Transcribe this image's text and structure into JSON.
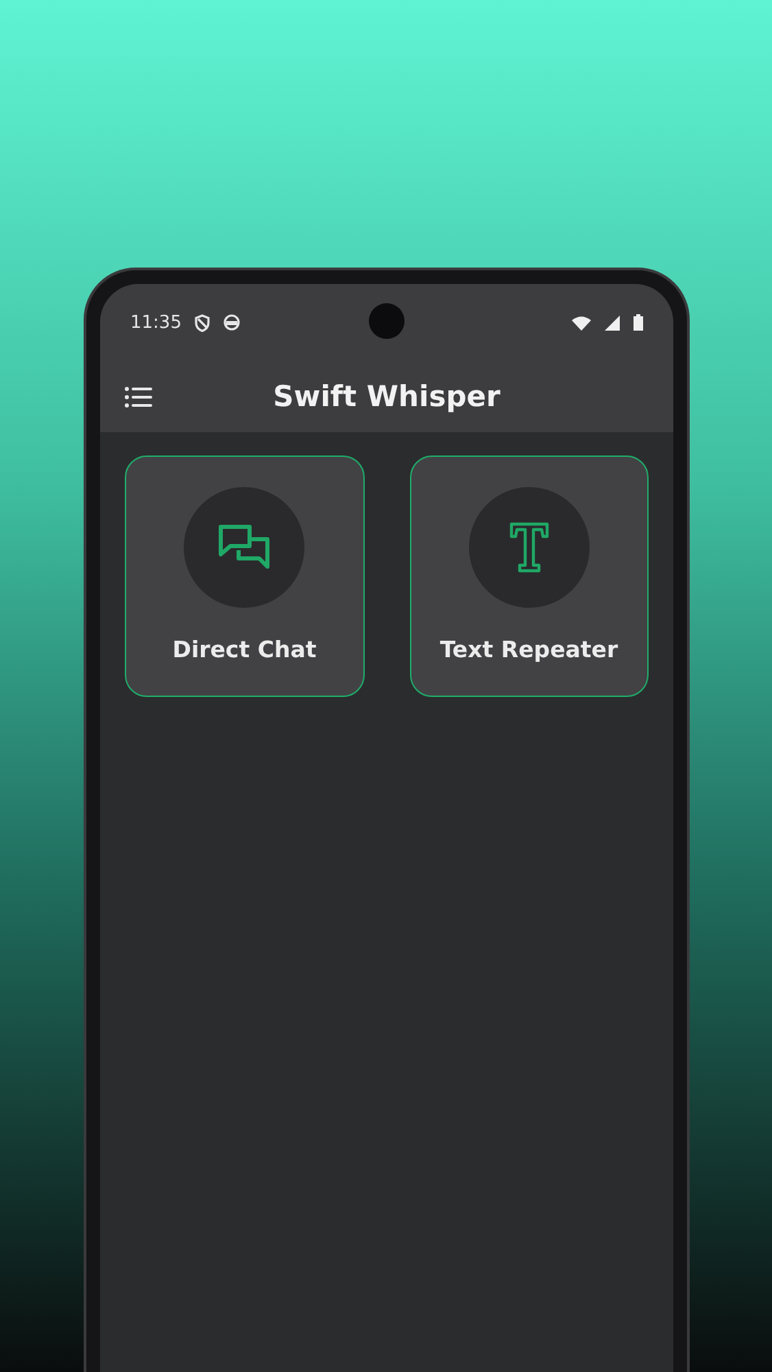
{
  "status_bar": {
    "time": "11:35"
  },
  "app_bar": {
    "title": "Swift Whisper"
  },
  "cards": [
    {
      "kind": "chat",
      "label": "Direct Chat"
    },
    {
      "kind": "text",
      "label": "Text Repeater"
    }
  ]
}
